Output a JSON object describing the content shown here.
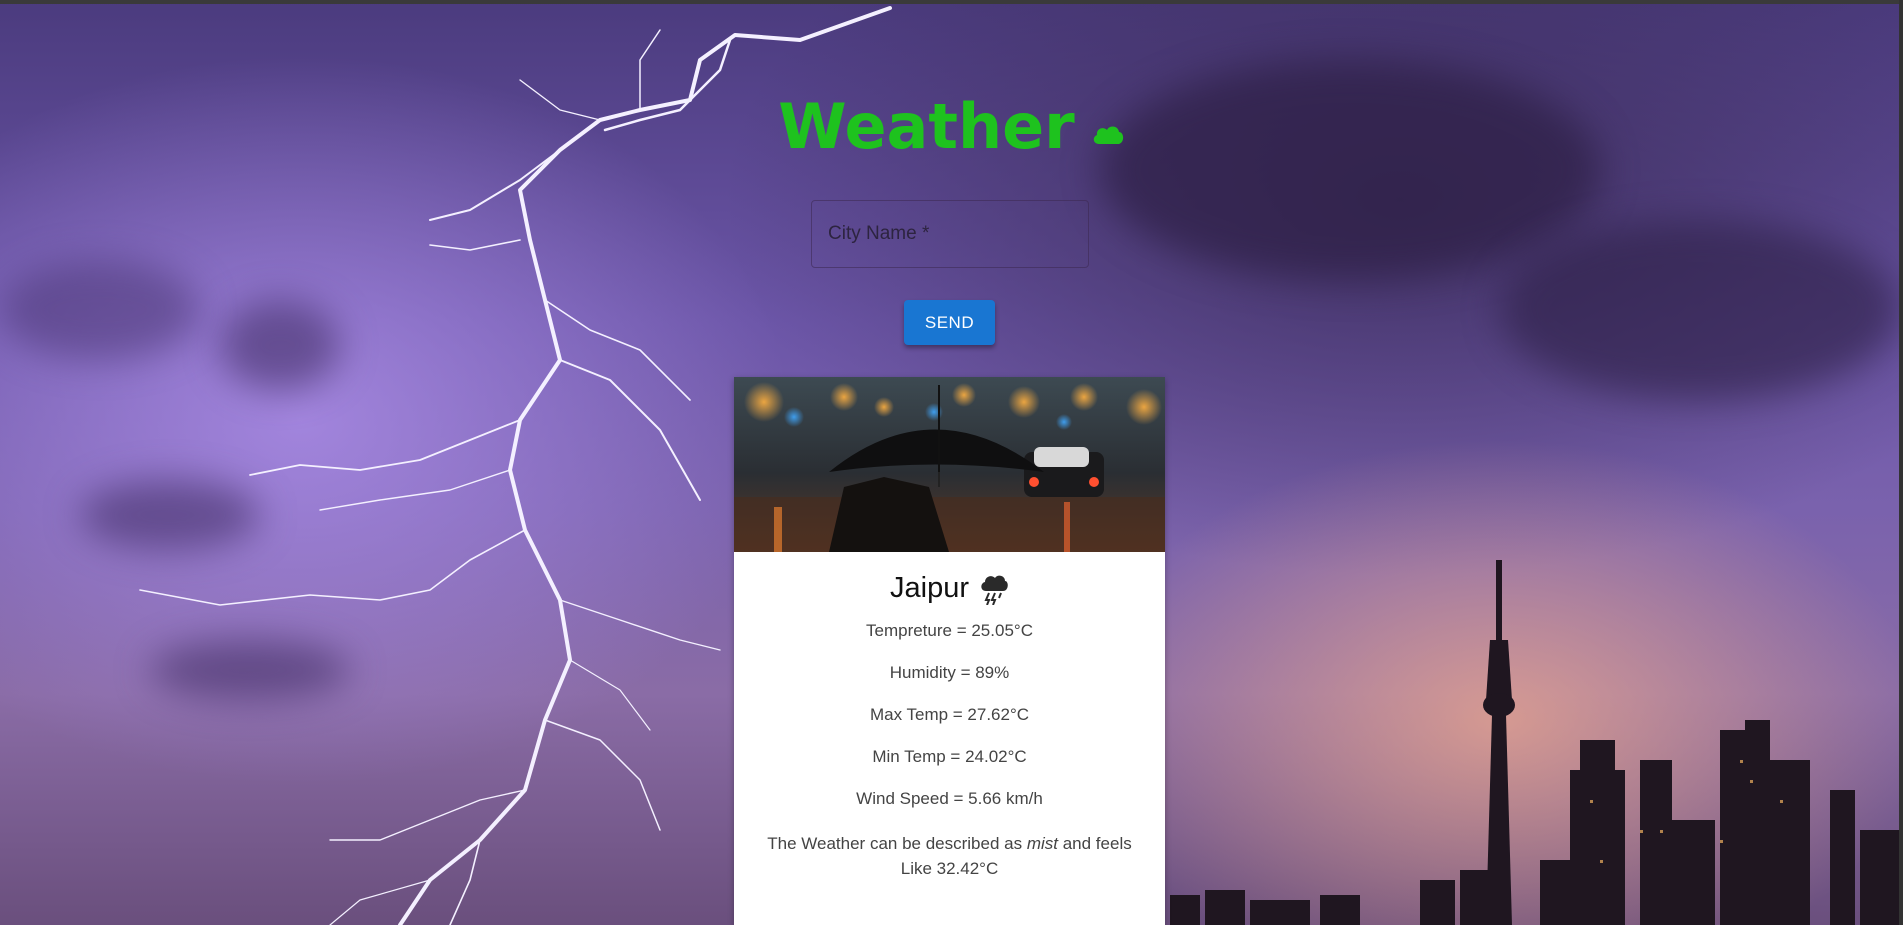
{
  "app": {
    "title": "Weather",
    "title_icon": "cloud-icon",
    "accent_color": "#1ec21e",
    "button_color": "#1976d2"
  },
  "search": {
    "placeholder": "City Name *",
    "value": "",
    "send_label": "SEND"
  },
  "result": {
    "image_description_icon": "umbrella-rain-image",
    "city": "Jaipur",
    "weather_icon": "thunderstorm-cloud-icon",
    "temperature": "Tempreture = 25.05°C",
    "humidity": "Humidity = 89%",
    "max_temp": "Max Temp = 27.62°C",
    "min_temp": "Min Temp = 24.02°C",
    "wind_speed": "Wind Speed = 5.66 km/h",
    "desc_prefix": "The Weather can be described as ",
    "desc_condition": "mist",
    "desc_suffix": " and feels Like 32.42°C"
  }
}
